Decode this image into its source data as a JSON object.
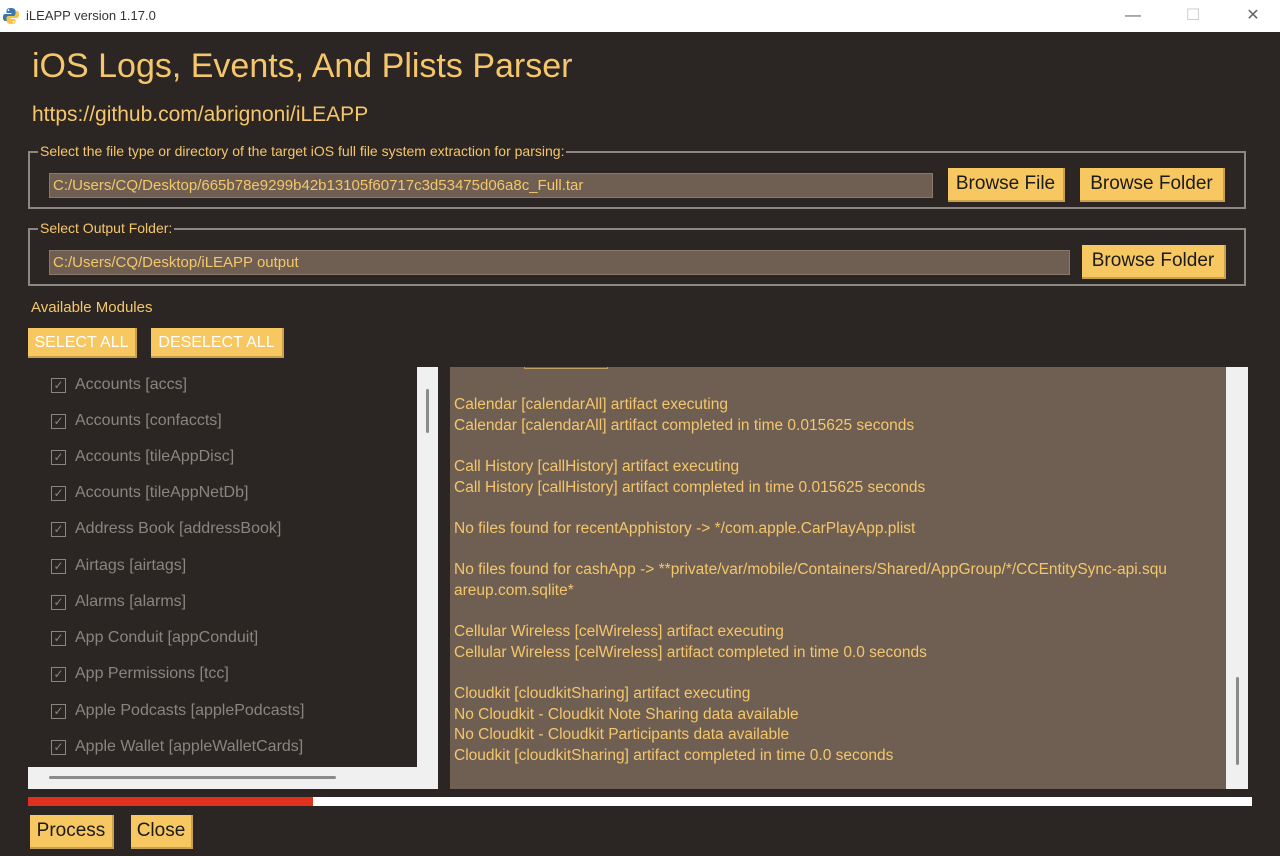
{
  "window": {
    "title": "iLEAPP version 1.17.0",
    "minimize": "—",
    "maximize": "☐",
    "close": "✕"
  },
  "header": {
    "title": "iOS Logs, Events, And Plists Parser",
    "url": "https://github.com/abrignoni/iLEAPP"
  },
  "input_group": {
    "legend": "Select the file type or directory of the target iOS full file system extraction for parsing:",
    "path": "C:/Users/CQ/Desktop/665b78e9299b42b13105f60717c3d53475d06a8c_Full.tar",
    "browse_file": "Browse File",
    "browse_folder": "Browse Folder"
  },
  "output_group": {
    "legend": "Select Output Folder:",
    "path": "C:/Users/CQ/Desktop/iLEAPP output",
    "browse_folder": "Browse Folder"
  },
  "modules": {
    "label": "Available Modules",
    "select_all": "SELECT ALL",
    "deselect_all": "DESELECT ALL",
    "check_glyph": "✓",
    "items": [
      "Accounts [accs]",
      "Accounts [confaccts]",
      "Accounts [tileAppDisc]",
      "Accounts [tileAppNetDb]",
      "Address Book [addressBook]",
      "Airtags [airtags]",
      "Alarms [alarms]",
      "App Conduit [appConduit]",
      "App Permissions [tcc]",
      "Apple Podcasts [applePodcasts]",
      "Apple Wallet [appleWalletCards]"
    ]
  },
  "log": {
    "lines": [
      "Calendar [calendarAll] artifact executing",
      "Calendar [calendarAll] artifact completed in time 0.015625 seconds",
      "Call History [callHistory] artifact executing",
      "Call History [callHistory] artifact completed in time 0.015625 seconds",
      "No files found for recentApphistory -> */com.apple.CarPlayApp.plist",
      "No files found for cashApp -> **private/var/mobile/Containers/Shared/AppGroup/*/CCEntitySync-api.squ",
      "areup.com.sqlite*",
      "Cellular Wireless [celWireless] artifact executing",
      "Cellular Wireless [celWireless] artifact completed in time 0.0 seconds",
      "Cloudkit [cloudkitSharing] artifact executing",
      "No Cloudkit - Cloudkit Note Sharing data available",
      "No Cloudkit - Cloudkit Participants data available",
      "Cloudkit [cloudkitSharing] artifact completed in time 0.0 seconds"
    ]
  },
  "progress": {
    "fraction": 0.233
  },
  "footer": {
    "process": "Process",
    "close": "Close"
  }
}
